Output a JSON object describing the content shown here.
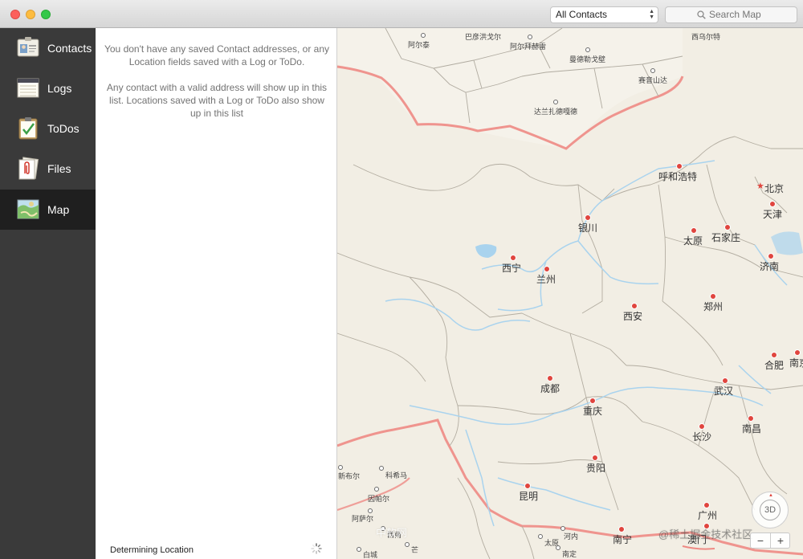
{
  "window": {
    "controls": [
      "close",
      "minimize",
      "zoom"
    ]
  },
  "toolbar": {
    "contacts_filter": "All Contacts",
    "search_placeholder": "Search Map"
  },
  "sidebar": {
    "items": [
      {
        "label": "Contacts",
        "icon": "contact-card-icon"
      },
      {
        "label": "Logs",
        "icon": "notepad-icon"
      },
      {
        "label": "ToDos",
        "icon": "clipboard-check-icon"
      },
      {
        "label": "Files",
        "icon": "paperclip-icon"
      },
      {
        "label": "Map",
        "icon": "map-icon",
        "selected": true
      }
    ]
  },
  "list": {
    "empty_line1": "You don't have any saved Contact addresses, or any Location fields saved with a Log or ToDo.",
    "empty_line2": "Any contact with a valid address will show up in this list. Locations saved with a Log or ToDo also show up in this list",
    "status": "Determining Location"
  },
  "map": {
    "labels": {
      "c01": "阿尔泰",
      "c02": "巴彦洪戈尔",
      "c03": "阿尔拜赫雷",
      "c04": "曼德勒戈壁",
      "c05": "赛音山达",
      "c06": "西乌尔特",
      "c07": "达兰扎德嘎德",
      "c08": "呼和浩特",
      "c09": "北京",
      "c10": "天津",
      "c11": "银川",
      "c12": "太原",
      "c13": "石家庄",
      "c14": "西宁",
      "c15": "兰州",
      "c16": "济南",
      "c17": "郑州",
      "c18": "西安",
      "c19": "合肥",
      "c20": "南京",
      "c21": "成都",
      "c22": "武汉",
      "c23": "重庆",
      "c24": "长沙",
      "c25": "南昌",
      "c26": "贵阳",
      "c27": "昆明",
      "c28": "广州",
      "c29": "南宁",
      "c30": "澳门",
      "c31": "新布尔",
      "c32": "科希马",
      "c33": "因帕尔",
      "c34": "阿萨尔",
      "c35": "西南",
      "c36": "河内",
      "c37": "太原",
      "c38": "南定",
      "c39": "芒",
      "c40": "白城"
    },
    "compass_label": "3D",
    "zoom_out": "−",
    "zoom_in": "+",
    "watermark_left": "中软网",
    "watermark_right": "@稀土掘金技术社区"
  },
  "colors": {
    "sidebar_bg": "#3a3a3a",
    "sidebar_selected": "#1f1f1f",
    "land": "#f2eee4",
    "water": "#a9d3ee",
    "border_line": "#ee8a84"
  }
}
